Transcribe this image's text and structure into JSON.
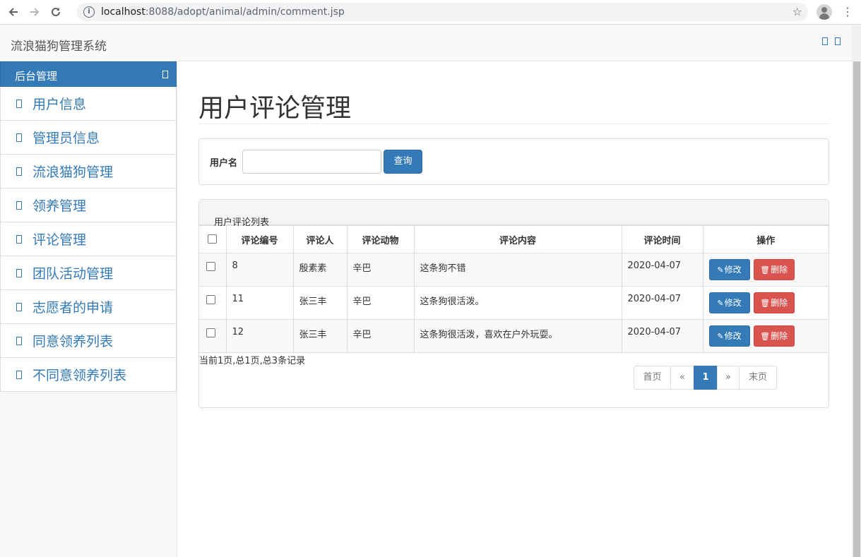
{
  "browser": {
    "url_host": "localhost",
    "url_rest": ":8088/adopt/animal/admin/comment.jsp"
  },
  "navbar": {
    "brand": "流浪猫狗管理系统"
  },
  "sidebar": {
    "header": "后台管理",
    "items": [
      {
        "label": "用户信息"
      },
      {
        "label": "管理员信息"
      },
      {
        "label": "流浪猫狗管理"
      },
      {
        "label": "领养管理"
      },
      {
        "label": "评论管理"
      },
      {
        "label": "团队活动管理"
      },
      {
        "label": "志愿者的申请"
      },
      {
        "label": "同意领养列表"
      },
      {
        "label": "不同意领养列表"
      }
    ]
  },
  "main": {
    "title": "用户评论管理",
    "search": {
      "label": "用户名",
      "value": "",
      "button": "查询"
    },
    "list": {
      "heading": "用户评论列表",
      "columns": [
        "评论编号",
        "评论人",
        "评论动物",
        "评论内容",
        "评论时间",
        "操作"
      ],
      "rows": [
        {
          "id": "8",
          "user": "殷素素",
          "animal": "辛巴",
          "content": "这条狗不错",
          "time": "2020-04-07"
        },
        {
          "id": "11",
          "user": "张三丰",
          "animal": "辛巴",
          "content": "这条狗很活泼。",
          "time": "2020-04-07"
        },
        {
          "id": "12",
          "user": "张三丰",
          "animal": "辛巴",
          "content": "这条狗很活泼，喜欢在户外玩耍。",
          "time": "2020-04-07"
        }
      ],
      "edit_label": "修改",
      "delete_label": "删除",
      "summary": "当前1页,总1页,总3条记录"
    },
    "pagination": {
      "first": "首页",
      "prev": "«",
      "current": "1",
      "next": "»",
      "last": "末页"
    }
  },
  "icons": {
    "back": "arrow-left-icon",
    "forward": "arrow-right-icon",
    "reload": "reload-icon",
    "info": "info-icon",
    "star": "star-icon",
    "profile": "profile-icon",
    "menu": "kebab-menu-icon",
    "edit": "pencil-icon",
    "delete": "trash-icon"
  },
  "colors": {
    "primary": "#337ab7",
    "danger": "#d9534f"
  }
}
